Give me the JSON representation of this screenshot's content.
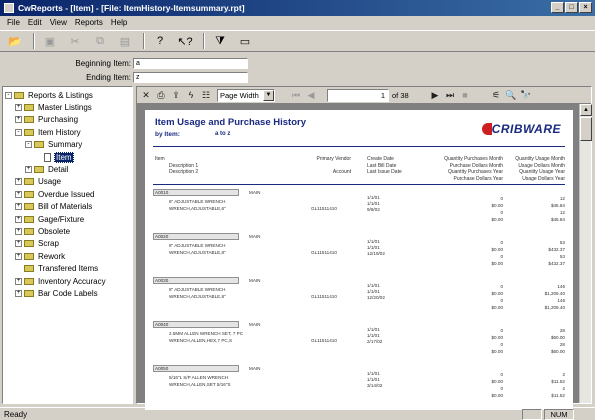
{
  "window": {
    "title": "CwReports - [Item] - [File: ItemHistory-Itemsummary.rpt]",
    "controls": [
      "_",
      "□",
      "×"
    ]
  },
  "menu": [
    "File",
    "Edit",
    "View",
    "Reports",
    "Help"
  ],
  "toolbar": [
    {
      "name": "open-folder-icon",
      "glyph": "📂",
      "enabled": true
    },
    {
      "name": "save-icon",
      "glyph": "▣",
      "enabled": false
    },
    {
      "name": "cut-icon",
      "glyph": "✂",
      "enabled": false
    },
    {
      "name": "copy-icon",
      "glyph": "⧉",
      "enabled": false
    },
    {
      "name": "paste-icon",
      "glyph": "▤",
      "enabled": false
    },
    {
      "name": "help-icon",
      "glyph": "?",
      "enabled": true
    },
    {
      "name": "context-help-icon",
      "glyph": "↖?",
      "enabled": true
    },
    {
      "name": "filter-icon",
      "glyph": "⧩",
      "enabled": true
    },
    {
      "name": "preview-icon",
      "glyph": "▭",
      "enabled": true
    }
  ],
  "range": {
    "begin_label": "Beginning Item:",
    "begin_value": "a",
    "end_label": "Ending Item:",
    "end_value": "z"
  },
  "tree": [
    {
      "label": "Reports & Listings",
      "level": 0,
      "exp": "-",
      "type": "folder"
    },
    {
      "label": "Master Listings",
      "level": 1,
      "exp": "+",
      "type": "folder"
    },
    {
      "label": "Purchasing",
      "level": 1,
      "exp": "+",
      "type": "folder"
    },
    {
      "label": "Item History",
      "level": 1,
      "exp": "-",
      "type": "folder"
    },
    {
      "label": "Summary",
      "level": 2,
      "exp": "-",
      "type": "folder"
    },
    {
      "label": "Item",
      "level": 3,
      "exp": "",
      "type": "doc",
      "selected": true
    },
    {
      "label": "Detail",
      "level": 2,
      "exp": "+",
      "type": "folder"
    },
    {
      "label": "Usage",
      "level": 1,
      "exp": "+",
      "type": "folder"
    },
    {
      "label": "Overdue Issued",
      "level": 1,
      "exp": "+",
      "type": "folder"
    },
    {
      "label": "Bill of Materials",
      "level": 1,
      "exp": "+",
      "type": "folder"
    },
    {
      "label": "Gage/Fixture",
      "level": 1,
      "exp": "+",
      "type": "folder"
    },
    {
      "label": "Obsolete",
      "level": 1,
      "exp": "+",
      "type": "folder"
    },
    {
      "label": "Scrap",
      "level": 1,
      "exp": "+",
      "type": "folder"
    },
    {
      "label": "Rework",
      "level": 1,
      "exp": "+",
      "type": "folder"
    },
    {
      "label": "Transfered Items",
      "level": 1,
      "exp": "",
      "type": "folder"
    },
    {
      "label": "Inventory Accuracy",
      "level": 1,
      "exp": "+",
      "type": "folder"
    },
    {
      "label": "Bar Code Labels",
      "level": 1,
      "exp": "+",
      "type": "folder"
    }
  ],
  "viewer": {
    "zoom": "Page Width",
    "page": "1",
    "of_pages": "of 38",
    "tools_left": [
      {
        "name": "close-report-icon",
        "glyph": "✕",
        "enabled": true
      },
      {
        "name": "print-icon",
        "glyph": "⎙",
        "enabled": true
      },
      {
        "name": "export-icon",
        "glyph": "⇪",
        "enabled": true
      },
      {
        "name": "lightning-icon",
        "glyph": "ϟ",
        "enabled": true
      },
      {
        "name": "toggle-tree-icon",
        "glyph": "☷",
        "enabled": true
      }
    ],
    "nav_left": [
      {
        "name": "first-page-icon",
        "glyph": "⏮",
        "enabled": false
      },
      {
        "name": "prev-page-icon",
        "glyph": "◀",
        "enabled": false
      }
    ],
    "nav_right": [
      {
        "name": "next-page-icon",
        "glyph": "▶",
        "enabled": true
      },
      {
        "name": "last-page-icon",
        "glyph": "⏭",
        "enabled": true
      },
      {
        "name": "stop-icon",
        "glyph": "■",
        "enabled": false
      }
    ],
    "tools_right": [
      {
        "name": "group-tree-icon",
        "glyph": "⚟",
        "enabled": true
      },
      {
        "name": "zoom-icon",
        "glyph": "🔍",
        "enabled": true
      },
      {
        "name": "search-icon",
        "glyph": "🔭",
        "enabled": true
      }
    ]
  },
  "report": {
    "title": "Item Usage and Purchase History",
    "by_label": "by Item:",
    "by_value": "a to z",
    "logo": "CRIBWARE",
    "headers": {
      "item": "Item",
      "desc1": "Description 1",
      "desc2": "Description 2",
      "vendor": "Primary Vendor",
      "account": "Account",
      "create": "Create Date",
      "lastdate": "Last Bill Date",
      "lastuse": "Last Issue Date",
      "q1": "Quantity Purchases Month",
      "q2": "Purchase Dollars Month",
      "q3": "Quantity Purchases Year",
      "q4": "Purchase Dollars Year",
      "u1": "Quantity Usage Month",
      "u2": "Usage Dollars Month",
      "u3": "Quantity Usage Year",
      "u4": "Usage Dollars Year"
    },
    "rows": [
      {
        "item": "A0010",
        "vendor": "MAIN",
        "desc1": "6\" ADJUSTABLE WRENCH",
        "desc2": "WRENCH,ADJUSTABLE,6\"",
        "account": "GL11511410",
        "d1": "1/1/01",
        "d2": "1/1/01",
        "d3": "9/8/02",
        "p": [
          "0",
          "$0.00",
          "0",
          "$0.00"
        ],
        "u": [
          "12",
          "$45.84",
          "12",
          "$45.84"
        ]
      },
      {
        "item": "A0020",
        "vendor": "MAIN",
        "desc1": "8\" ADJUSTABLE WRENCH",
        "desc2": "WRENCH,ADJUSTABLE,8\"",
        "account": "GL11511410",
        "d1": "1/1/01",
        "d2": "1/1/01",
        "d3": "12/19/02",
        "p": [
          "0",
          "$0.00",
          "0",
          "$0.00"
        ],
        "u": [
          "53",
          "$432.37",
          "53",
          "$432.37"
        ]
      },
      {
        "item": "A0030",
        "vendor": "MAIN",
        "desc1": "8\" ADJUSTABLE WRENCH",
        "desc2": "WRENCH,ADJUSTABLE,8\"",
        "account": "GL11511410",
        "d1": "1/1/01",
        "d2": "1/1/01",
        "d3": "12/20/02",
        "p": [
          "0",
          "$0.00",
          "0",
          "$0.00"
        ],
        "u": [
          "146",
          "$1,209.40",
          "146",
          "$1,209.40"
        ]
      },
      {
        "item": "A0040",
        "vendor": "MAIN",
        "desc1": "2.5MM ALLEN WRENCH SET, 7 PC",
        "desc2": "WRENCH,ALLEN,HEX,7 PC,S",
        "account": "GL11511410",
        "d1": "1/1/01",
        "d2": "1/1/01",
        "d3": "2/17/02",
        "p": [
          "0",
          "$0.00",
          "0",
          "$0.00"
        ],
        "u": [
          "28",
          "$60.00",
          "28",
          "$60.00"
        ]
      },
      {
        "item": "A0050",
        "vendor": "MAIN",
        "desc1": "5/16\"L S/P ALLEN WRENCH",
        "desc2": "WRENCH,ALLEN,SET 5/16\"S",
        "account": "",
        "d1": "1/1/01",
        "d2": "1/1/01",
        "d3": "3/14/02",
        "p": [
          "0",
          "$0.00",
          "0",
          "$0.00"
        ],
        "u": [
          "2",
          "$11.52",
          "2",
          "$11.52"
        ]
      }
    ]
  },
  "status": {
    "left": "Ready",
    "num": "NUM"
  }
}
